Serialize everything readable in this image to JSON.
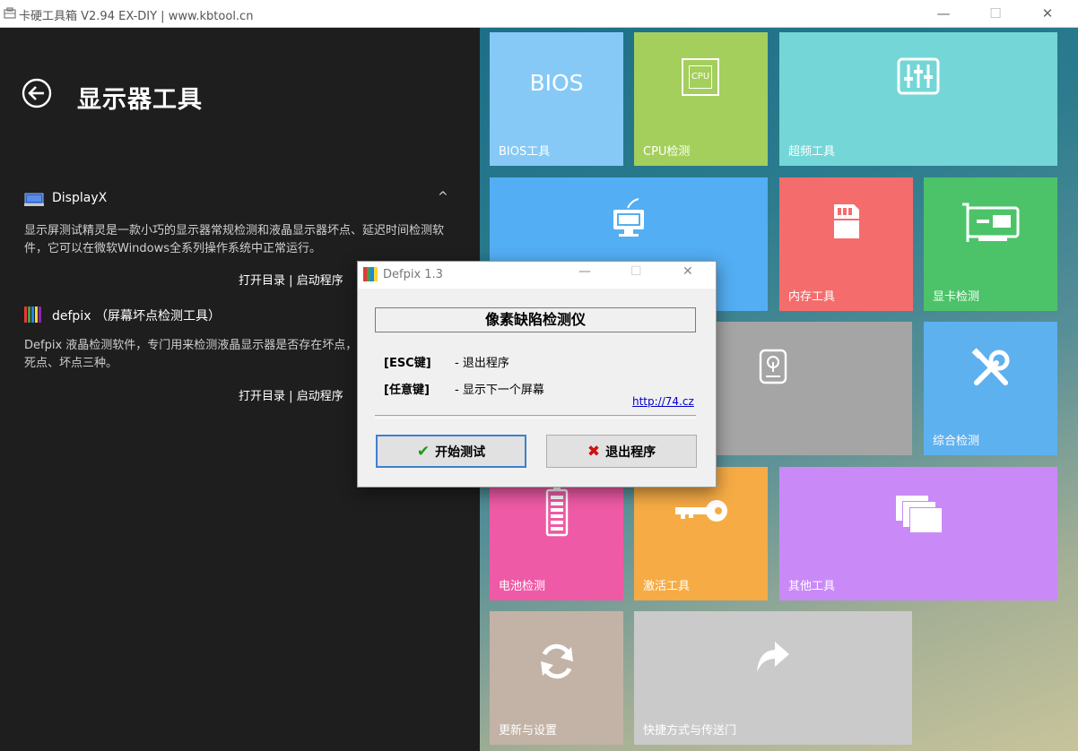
{
  "window": {
    "title": "卡硬工具箱 V2.94  EX-DIY   | www.kbtool.cn",
    "minimize": "—",
    "maximize": "☐",
    "close": "✕"
  },
  "left": {
    "page_title": "显示器工具",
    "collapse_icon": "chevron-up",
    "tools": [
      {
        "name": "DisplayX",
        "icon": "monitor-icon",
        "description": "显示屏测试精灵是一款小巧的显示器常规检测和液晶显示器坏点、延迟时间检测软件，它可以在微软Windows全系列操作系统中正常运行。",
        "open_dir": "打开目录",
        "separator": "|",
        "launch": "启动程序"
      },
      {
        "name": "defpix （屏幕坏点检测工具）",
        "icon": "color-bars-icon",
        "description": "Defpix 液晶检测软件，专门用来检测液晶显示器是否存在坏点，坏点分为：亮点、死点、坏点三种。",
        "open_dir": "打开目录",
        "separator": "|",
        "launch": "启动程序"
      }
    ]
  },
  "tiles": {
    "bios": {
      "label": "BIOS工具",
      "icon_text": "BIOS",
      "color": "#86c9f6"
    },
    "cpu": {
      "label": "CPU检测",
      "icon_text": "CPU",
      "color": "#a4cf5c"
    },
    "overclock": {
      "label": "超频工具",
      "color": "#74d6d6"
    },
    "monitor": {
      "label": "",
      "color": "#53aef3"
    },
    "memory": {
      "label": "内存工具",
      "color": "#f56c6c"
    },
    "gpu": {
      "label": "显卡检测",
      "color": "#4cc368"
    },
    "disk": {
      "label": "",
      "color": "#a5a5a5"
    },
    "overall": {
      "label": "综合检测",
      "color": "#5eb1ef"
    },
    "battery": {
      "label": "电池检测",
      "color": "#ef5aa6"
    },
    "activate": {
      "label": "激活工具",
      "color": "#f6ab45"
    },
    "others": {
      "label": "其他工具",
      "color": "#c98af8"
    },
    "update": {
      "label": "更新与设置",
      "color": "#c3b3a6"
    },
    "shortcut": {
      "label": "快捷方式与传送门",
      "color": "#cacaca"
    }
  },
  "dialog": {
    "title": "Defpix 1.3",
    "header": "像素缺陷检测仪",
    "keys": [
      {
        "key": "[ESC键]",
        "desc": "- 退出程序"
      },
      {
        "key": "[任意键]",
        "desc": "- 显示下一个屏幕"
      }
    ],
    "link": "http://74.cz",
    "start_button": "开始测试",
    "exit_button": "退出程序",
    "minimize": "—",
    "maximize": "☐",
    "close": "✕"
  }
}
